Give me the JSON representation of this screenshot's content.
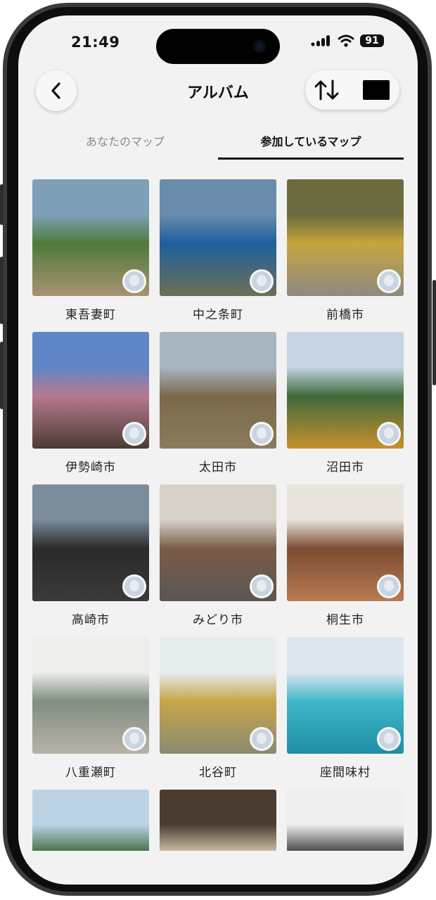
{
  "status_bar": {
    "time": "21:49",
    "battery": "91"
  },
  "header": {
    "title": "アルバム"
  },
  "tabs": [
    {
      "label": "あなたのマップ",
      "active": false
    },
    {
      "label": "参加しているマップ",
      "active": true
    }
  ],
  "albums": [
    {
      "name": "東吾妻町",
      "colors": [
        "#7ea0b8",
        "#4f7a3a",
        "#a99270"
      ]
    },
    {
      "name": "中之条町",
      "colors": [
        "#6a8cab",
        "#1f5f9e",
        "#6b6f55"
      ]
    },
    {
      "name": "前橋市",
      "colors": [
        "#6b6a3e",
        "#c6a53d",
        "#8d8a82"
      ]
    },
    {
      "name": "伊勢崎市",
      "colors": [
        "#5f86c6",
        "#b7798f",
        "#4a3c32"
      ]
    },
    {
      "name": "太田市",
      "colors": [
        "#a9b6c2",
        "#7a6a4a",
        "#8b7b5e"
      ]
    },
    {
      "name": "沼田市",
      "colors": [
        "#c6d4e3",
        "#3f6a3a",
        "#c7902e"
      ]
    },
    {
      "name": "高崎市",
      "colors": [
        "#7b8c9a",
        "#2a2a2c",
        "#3c3a38"
      ]
    },
    {
      "name": "みどり市",
      "colors": [
        "#d6d2c8",
        "#7a5c46",
        "#5a5654"
      ]
    },
    {
      "name": "桐生市",
      "colors": [
        "#e9e4dd",
        "#7b4d33",
        "#b97b52"
      ]
    },
    {
      "name": "八重瀬町",
      "colors": [
        "#eeeeea",
        "#7f8e80",
        "#b9b2a6"
      ]
    },
    {
      "name": "北谷町",
      "colors": [
        "#e7ecef",
        "#c6a64a",
        "#8b8a6f"
      ]
    },
    {
      "name": "座間味村",
      "colors": [
        "#dfe7ee",
        "#3fb7c9",
        "#1d8ea6"
      ]
    },
    {
      "name": "",
      "colors": [
        "#bcd3e6",
        "#3c6a3c",
        "#9fb2a0"
      ]
    },
    {
      "name": "",
      "colors": [
        "#4b3d31",
        "#d6c7ad",
        "#8d6c3f"
      ]
    },
    {
      "name": "",
      "colors": [
        "#eeeeee",
        "#3a3a3a",
        "#d7cfc0"
      ]
    }
  ],
  "icons": {
    "back": "chevron-left-icon",
    "sort": "sort-arrows-icon",
    "signal": "cellular-signal-icon",
    "wifi": "wifi-icon",
    "battery": "battery-icon"
  }
}
